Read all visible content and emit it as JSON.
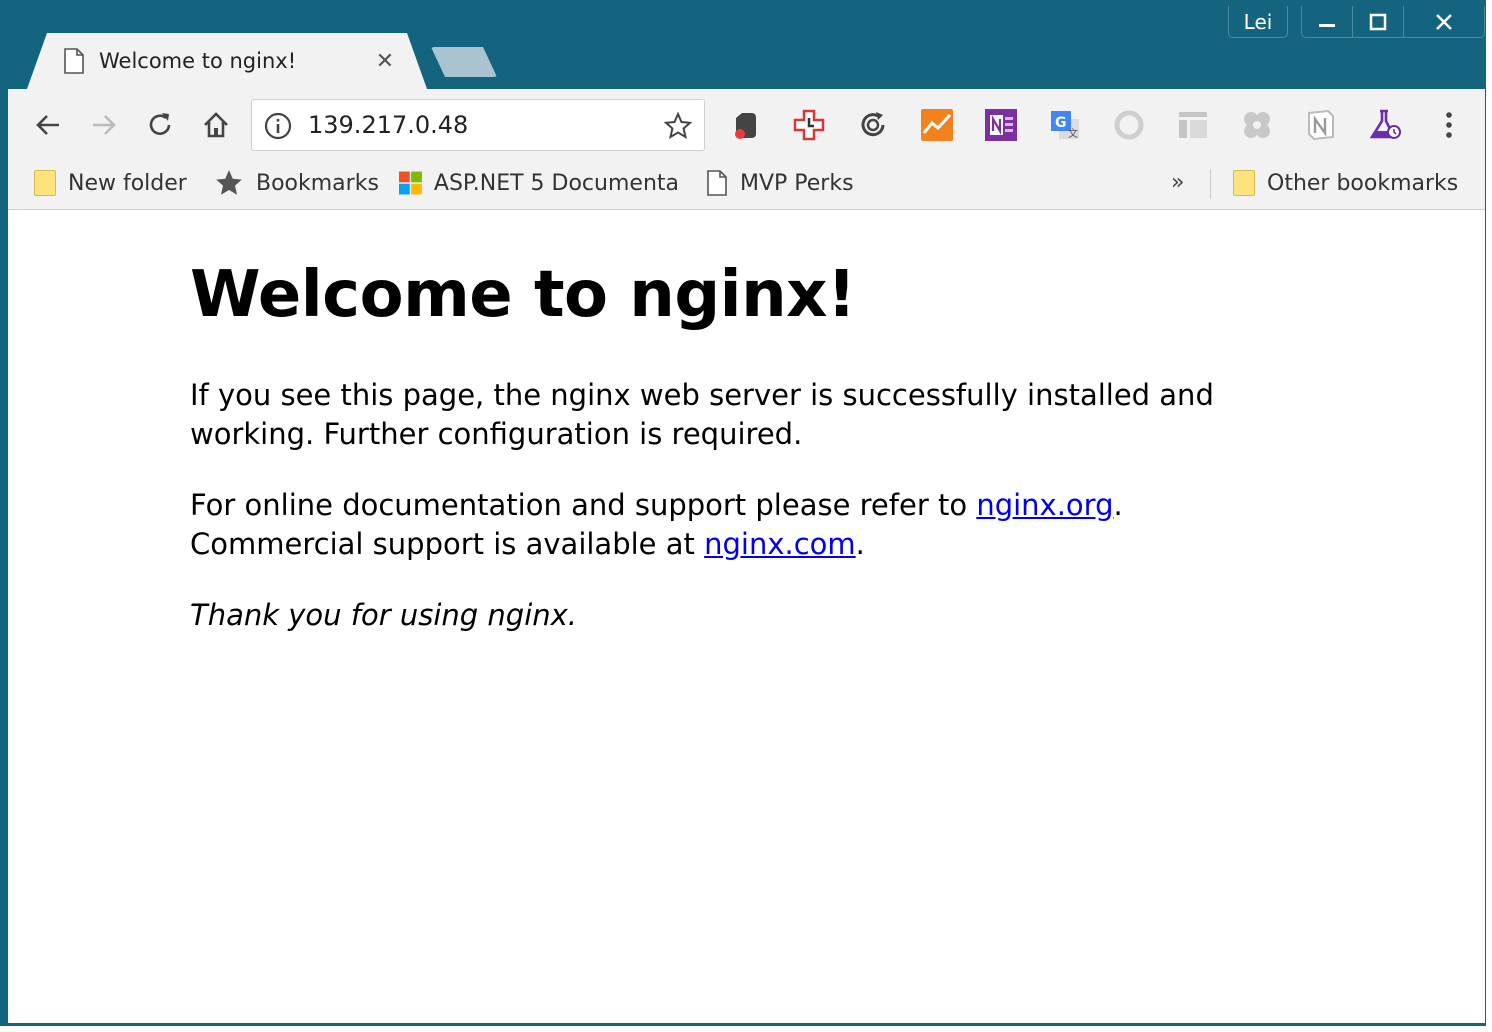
{
  "window": {
    "user": "Lei",
    "controls": {
      "minimize": "minimize",
      "maximize": "maximize",
      "close": "close"
    }
  },
  "tab": {
    "title": "Welcome to nginx!",
    "close_glyph": "✕"
  },
  "toolbar": {
    "url": "139.217.0.48",
    "extensions": [
      "evernote-icon",
      "clock-extension-icon",
      "sync-icon",
      "analytics-icon",
      "onenote-icon",
      "google-translate-icon",
      "ring-icon",
      "layout-icon",
      "apps-icon",
      "notion-icon",
      "flask-icon"
    ]
  },
  "bookmarks": {
    "items": [
      {
        "label": "New folder",
        "icon": "folder-icon"
      },
      {
        "label": "Bookmarks",
        "icon": "star-icon"
      },
      {
        "label": "ASP.NET 5 Documenta",
        "icon": "microsoft-icon"
      },
      {
        "label": "MVP Perks",
        "icon": "page-icon"
      }
    ],
    "more": "»",
    "other": "Other bookmarks"
  },
  "page": {
    "heading": "Welcome to nginx!",
    "p1": "If you see this page, the nginx web server is successfully installed and working. Further configuration is required.",
    "p2_a": "For online documentation and support please refer to ",
    "p2_link1": "nginx.org",
    "p2_b": ".",
    "p2_c": "Commercial support is available at ",
    "p2_link2": "nginx.com",
    "p2_d": ".",
    "p3": "Thank you for using nginx."
  },
  "colors": {
    "frame": "#15647f",
    "link": "#0000ee",
    "toolbar": "#f2f2f2"
  }
}
